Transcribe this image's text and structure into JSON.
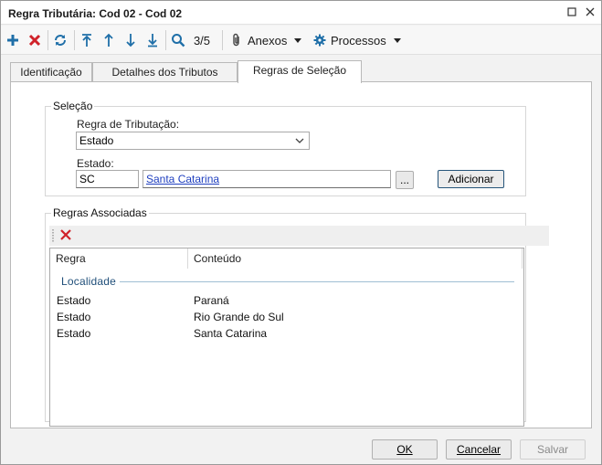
{
  "window": {
    "title": "Regra Tributária: Cod 02 - Cod 02",
    "maximize_icon": "square-outline",
    "close_icon": "x"
  },
  "toolbar": {
    "add_icon": "plus-icon",
    "delete_icon": "red-x-icon",
    "refresh_icon": "refresh-icon",
    "first_icon": "arrow-to-top-icon",
    "prev_icon": "arrow-up-icon",
    "next_icon": "arrow-down-icon",
    "last_icon": "arrow-to-bottom-icon",
    "search_icon": "magnifier-icon",
    "record_position": "3/5",
    "attachments_label": "Anexos",
    "processes_label": "Processos",
    "accent_color": "#1f6fa8"
  },
  "tabs": [
    {
      "label": "Identificação",
      "active": false
    },
    {
      "label": "Detalhes dos Tributos",
      "active": false
    },
    {
      "label": "Regras de Seleção",
      "active": true
    }
  ],
  "selection": {
    "legend": "Seleção",
    "rule_label": "Regra de Tributação:",
    "rule_value": "Estado",
    "state_label": "Estado:",
    "state_code": "SC",
    "state_name": "Santa Catarina",
    "lookup_button": "...",
    "add_button": "Adicionar"
  },
  "associated": {
    "legend": "Regras Associadas",
    "delete_icon": "red-x-icon",
    "columns": [
      "Regra",
      "Conteúdo"
    ],
    "group": "Localidade",
    "rows": [
      {
        "rule": "Estado",
        "content": "Paraná"
      },
      {
        "rule": "Estado",
        "content": "Rio Grande do Sul"
      },
      {
        "rule": "Estado",
        "content": "Santa Catarina"
      }
    ]
  },
  "footer": {
    "ok_label": "OK",
    "cancel_label": "Cancelar",
    "save_label": "Salvar"
  }
}
